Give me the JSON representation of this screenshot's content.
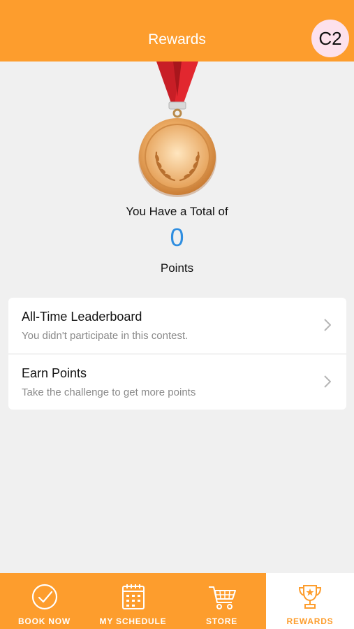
{
  "header": {
    "title": "Rewards",
    "avatar_text": "C2"
  },
  "summary": {
    "total_label": "You Have a Total of",
    "points": "0",
    "points_unit": "Points"
  },
  "list": [
    {
      "title": "All-Time Leaderboard",
      "subtitle": "You didn't participate in this contest."
    },
    {
      "title": "Earn Points",
      "subtitle": "Take the challenge to get more points"
    }
  ],
  "tabs": [
    {
      "label": "BOOK NOW",
      "icon": "check-circle-icon"
    },
    {
      "label": "MY SCHEDULE",
      "icon": "calendar-icon"
    },
    {
      "label": "STORE",
      "icon": "shopping-cart-icon"
    },
    {
      "label": "REWARDS",
      "icon": "trophy-icon",
      "active": true
    }
  ],
  "colors": {
    "accent": "#fd9d2d",
    "points": "#2f8ee0",
    "background": "#f0f0f0"
  }
}
